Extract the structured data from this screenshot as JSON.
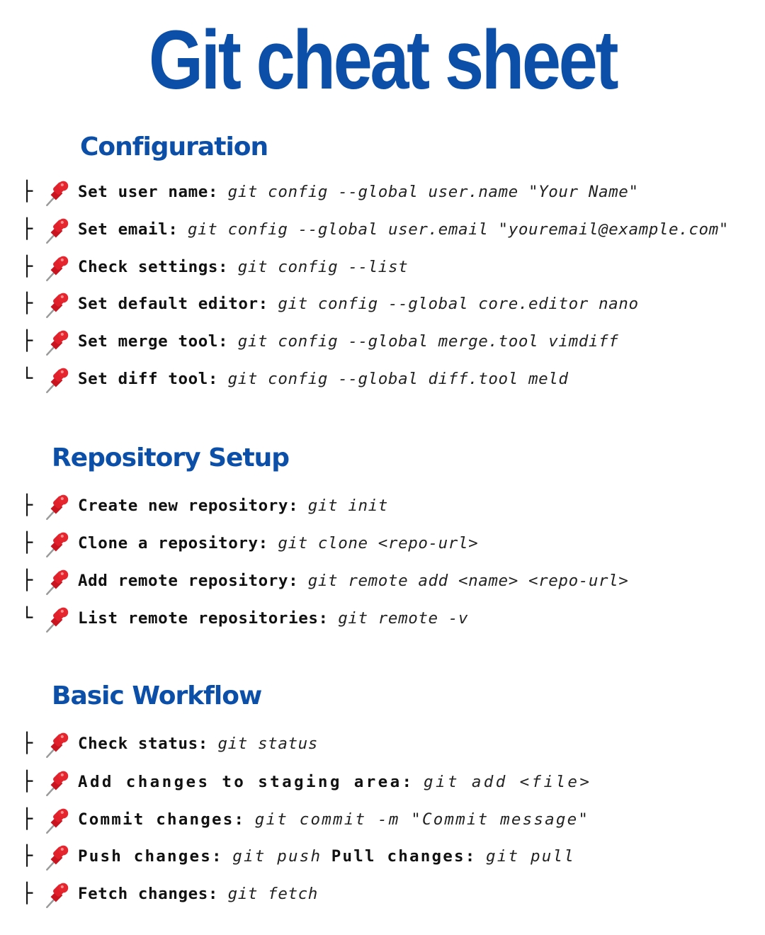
{
  "title": "Git cheat sheet",
  "colors": {
    "heading": "#0b4fa8",
    "pin_red": "#e0202a"
  },
  "icons": {
    "bullet": "pushpin-icon",
    "branch_mid": "├",
    "branch_end": "└"
  },
  "sections": [
    {
      "heading": "Configuration",
      "items": [
        {
          "branch": "├",
          "label": "Set user name:",
          "command": "git config --global user.name \"Your Name\""
        },
        {
          "branch": "├",
          "label": "Set email:",
          "command": "git config --global user.email \"youremail@example.com\""
        },
        {
          "branch": "├",
          "label": "Check settings:",
          "command": "git config --list"
        },
        {
          "branch": "├",
          "label": "Set default editor:",
          "command": "git config --global core.editor nano"
        },
        {
          "branch": "├",
          "label": "Set merge tool:",
          "command": "git config --global merge.tool vimdiff"
        },
        {
          "branch": "└",
          "label": "Set diff tool:",
          "command": "git config --global diff.tool meld"
        }
      ]
    },
    {
      "heading": "Repository Setup",
      "items": [
        {
          "branch": "├",
          "label": "Create new repository:",
          "command": "git init"
        },
        {
          "branch": "├",
          "label": "Clone a repository:",
          "command": "git clone <repo-url>"
        },
        {
          "branch": "├",
          "label": "Add remote repository:",
          "command": "git remote add <name> <repo-url>"
        },
        {
          "branch": "└",
          "label": "List remote repositories:",
          "command": "git remote -v"
        }
      ]
    },
    {
      "heading": "Basic Workflow",
      "items": [
        {
          "branch": "├",
          "label": "Check status:",
          "command": "git status"
        },
        {
          "branch": "├",
          "label": "Add changes to staging area:",
          "command": "git add <file>"
        },
        {
          "branch": "├",
          "label": "Commit changes:",
          "command": "git commit -m \"Commit message\""
        },
        {
          "branch": "├",
          "label": "Push changes:",
          "command": "git push",
          "label2": "Pull changes:",
          "command2": "git pull"
        },
        {
          "branch": "├",
          "label": "Fetch changes:",
          "command": "git fetch"
        }
      ]
    }
  ]
}
